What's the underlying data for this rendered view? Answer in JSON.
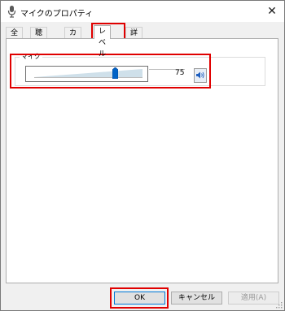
{
  "window": {
    "title": "マイクのプロパティ",
    "close_symbol": "✕"
  },
  "tabs": [
    {
      "label": "全般",
      "active": false
    },
    {
      "label": "聴く",
      "active": false
    },
    {
      "label": "カスタム",
      "active": false
    },
    {
      "label": "レベル",
      "active": true
    },
    {
      "label": "詳細",
      "active": false
    }
  ],
  "levels": {
    "group_label": "マイク",
    "value": "75",
    "slider_fraction": 0.75
  },
  "buttons": {
    "ok": "OK",
    "cancel": "キャンセル",
    "apply": "適用(A)"
  },
  "colors": {
    "highlight": "#e00000",
    "thumb": "#0063c7",
    "accent": "#0078d7"
  },
  "icons": {
    "app": "microphone-icon",
    "mute": "speaker-icon",
    "close": "close-icon"
  }
}
